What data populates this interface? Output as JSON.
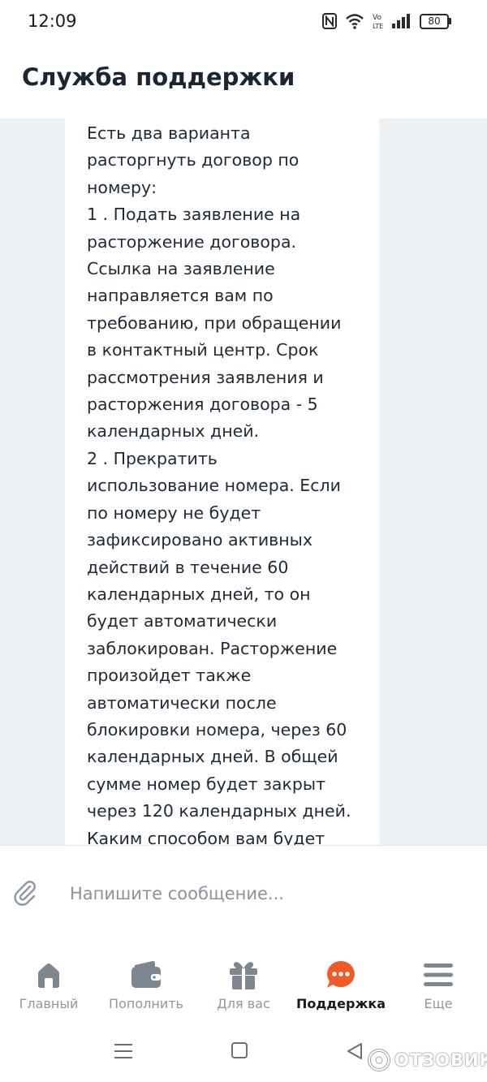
{
  "status_bar": {
    "time": "12:09",
    "battery": "80",
    "icons": [
      "nfc-icon",
      "wifi-icon",
      "volte-icon",
      "signal-icon",
      "battery-icon"
    ]
  },
  "header": {
    "title": "Служба поддержки"
  },
  "message": {
    "lines": [
      "Есть два варианта",
      "расторгнуть договор по",
      "номеру:",
      "1 . Подать заявление на",
      "расторжение договора.",
      "Ссылка на заявление",
      "направляется вам по",
      "требованию, при обращении",
      "в контактный центр. Срок",
      "рассмотрения заявления и",
      "расторжения договора - 5",
      "календарных дней.",
      "2 . Прекратить",
      "использование номера. Если",
      "по номеру не будет",
      "зафиксировано активных",
      "действий в течение 60",
      "календарных дней, то он",
      "будет автоматически",
      "заблокирован. Расторжение",
      "произойдет также",
      "автоматически после",
      "блокировки номера, через 60",
      "календарных дней. В общей",
      "сумме номер будет закрыт",
      "через 120 календарных дней.",
      "Каким способом вам будет"
    ]
  },
  "composer": {
    "placeholder": "Напишите сообщение...",
    "value": "",
    "attach_icon": "paperclip-icon"
  },
  "bottom_nav": {
    "items": [
      {
        "label": "Главный",
        "icon": "home-icon",
        "active": false
      },
      {
        "label": "Пополнить",
        "icon": "wallet-icon",
        "active": false
      },
      {
        "label": "Для вас",
        "icon": "gift-icon",
        "active": false
      },
      {
        "label": "Поддержка",
        "icon": "chat-bubble-icon",
        "active": true
      },
      {
        "label": "Еще",
        "icon": "menu-icon",
        "active": false
      }
    ]
  },
  "colors": {
    "accent": "#f05a28",
    "nav_icon": "#7c8791",
    "chat_background": "#eef1f4",
    "text": "#1f2a36"
  },
  "watermark": {
    "text": "ОТЗОВИК"
  }
}
